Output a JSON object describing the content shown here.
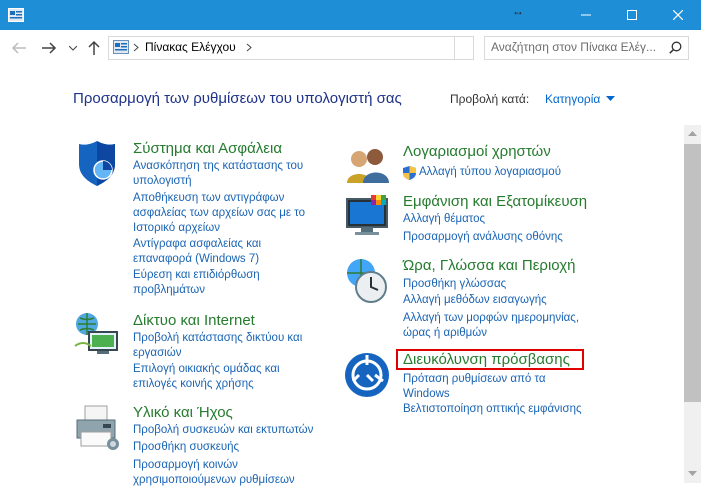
{
  "window": {
    "minimize_icon": "minimize-icon",
    "maximize_icon": "maximize-icon",
    "close_icon": "close-icon"
  },
  "nav": {
    "breadcrumb": "Πίνακας Ελέγχου",
    "search_placeholder": "Αναζήτηση στον Πίνακα Ελέγ..."
  },
  "main": {
    "heading": "Προσαρμογή των ρυθμίσεων του υπολογιστή σας",
    "view_by_label": "Προβολή κατά:",
    "view_by_value": "Κατηγορία"
  },
  "categories": {
    "system": {
      "title": "Σύστημα και Ασφάλεια",
      "links": [
        [
          "Ανασκόπηση της κατάστασης του",
          "υπολογιστή"
        ],
        [
          "Αποθήκευση των αντιγράφων",
          "ασφαλείας των αρχείων σας με το",
          "Ιστορικό αρχείων"
        ],
        [
          "Αντίγραφα ασφαλείας και",
          "επαναφορά (Windows 7)"
        ],
        [
          "Εύρεση και επιδιόρθωση",
          "προβλημάτων"
        ]
      ]
    },
    "network": {
      "title": "Δίκτυο και Internet",
      "links": [
        [
          "Προβολή κατάστασης δικτύου και",
          "εργασιών"
        ],
        [
          "Επιλογή οικιακής ομάδας και",
          "επιλογές κοινής χρήσης"
        ]
      ]
    },
    "hardware": {
      "title": "Υλικό και Ήχος",
      "links": [
        [
          "Προβολή συσκευών και εκτυπωτών"
        ],
        [
          "Προσθήκη συσκευής"
        ],
        [
          "Προσαρμογή κοινών",
          "χρησιμοποιούμενων ρυθμίσεων"
        ]
      ]
    },
    "accounts": {
      "title": "Λογαριασμοί χρηστών",
      "links": [
        [
          "Αλλαγή τύπου λογαριασμού"
        ]
      ]
    },
    "appearance": {
      "title": "Εμφάνιση και Εξατομίκευση",
      "links": [
        [
          "Αλλαγή θέματος"
        ],
        [
          "Προσαρμογή ανάλυσης οθόνης"
        ]
      ]
    },
    "clock": {
      "title": "Ώρα, Γλώσσα και Περιοχή",
      "links": [
        [
          "Προσθήκη γλώσσας"
        ],
        [
          "Αλλαγή μεθόδων εισαγωγής"
        ],
        [
          "Αλλαγή των μορφών ημερομηνίας,",
          "ώρας ή αριθμών"
        ]
      ]
    },
    "access": {
      "title": "Διευκόλυνση πρόσβασης",
      "links": [
        [
          "Πρόταση ρυθμίσεων από τα",
          "Windows"
        ],
        [
          "Βελτιστοποίηση οπτικής εμφάνισης"
        ]
      ]
    }
  }
}
